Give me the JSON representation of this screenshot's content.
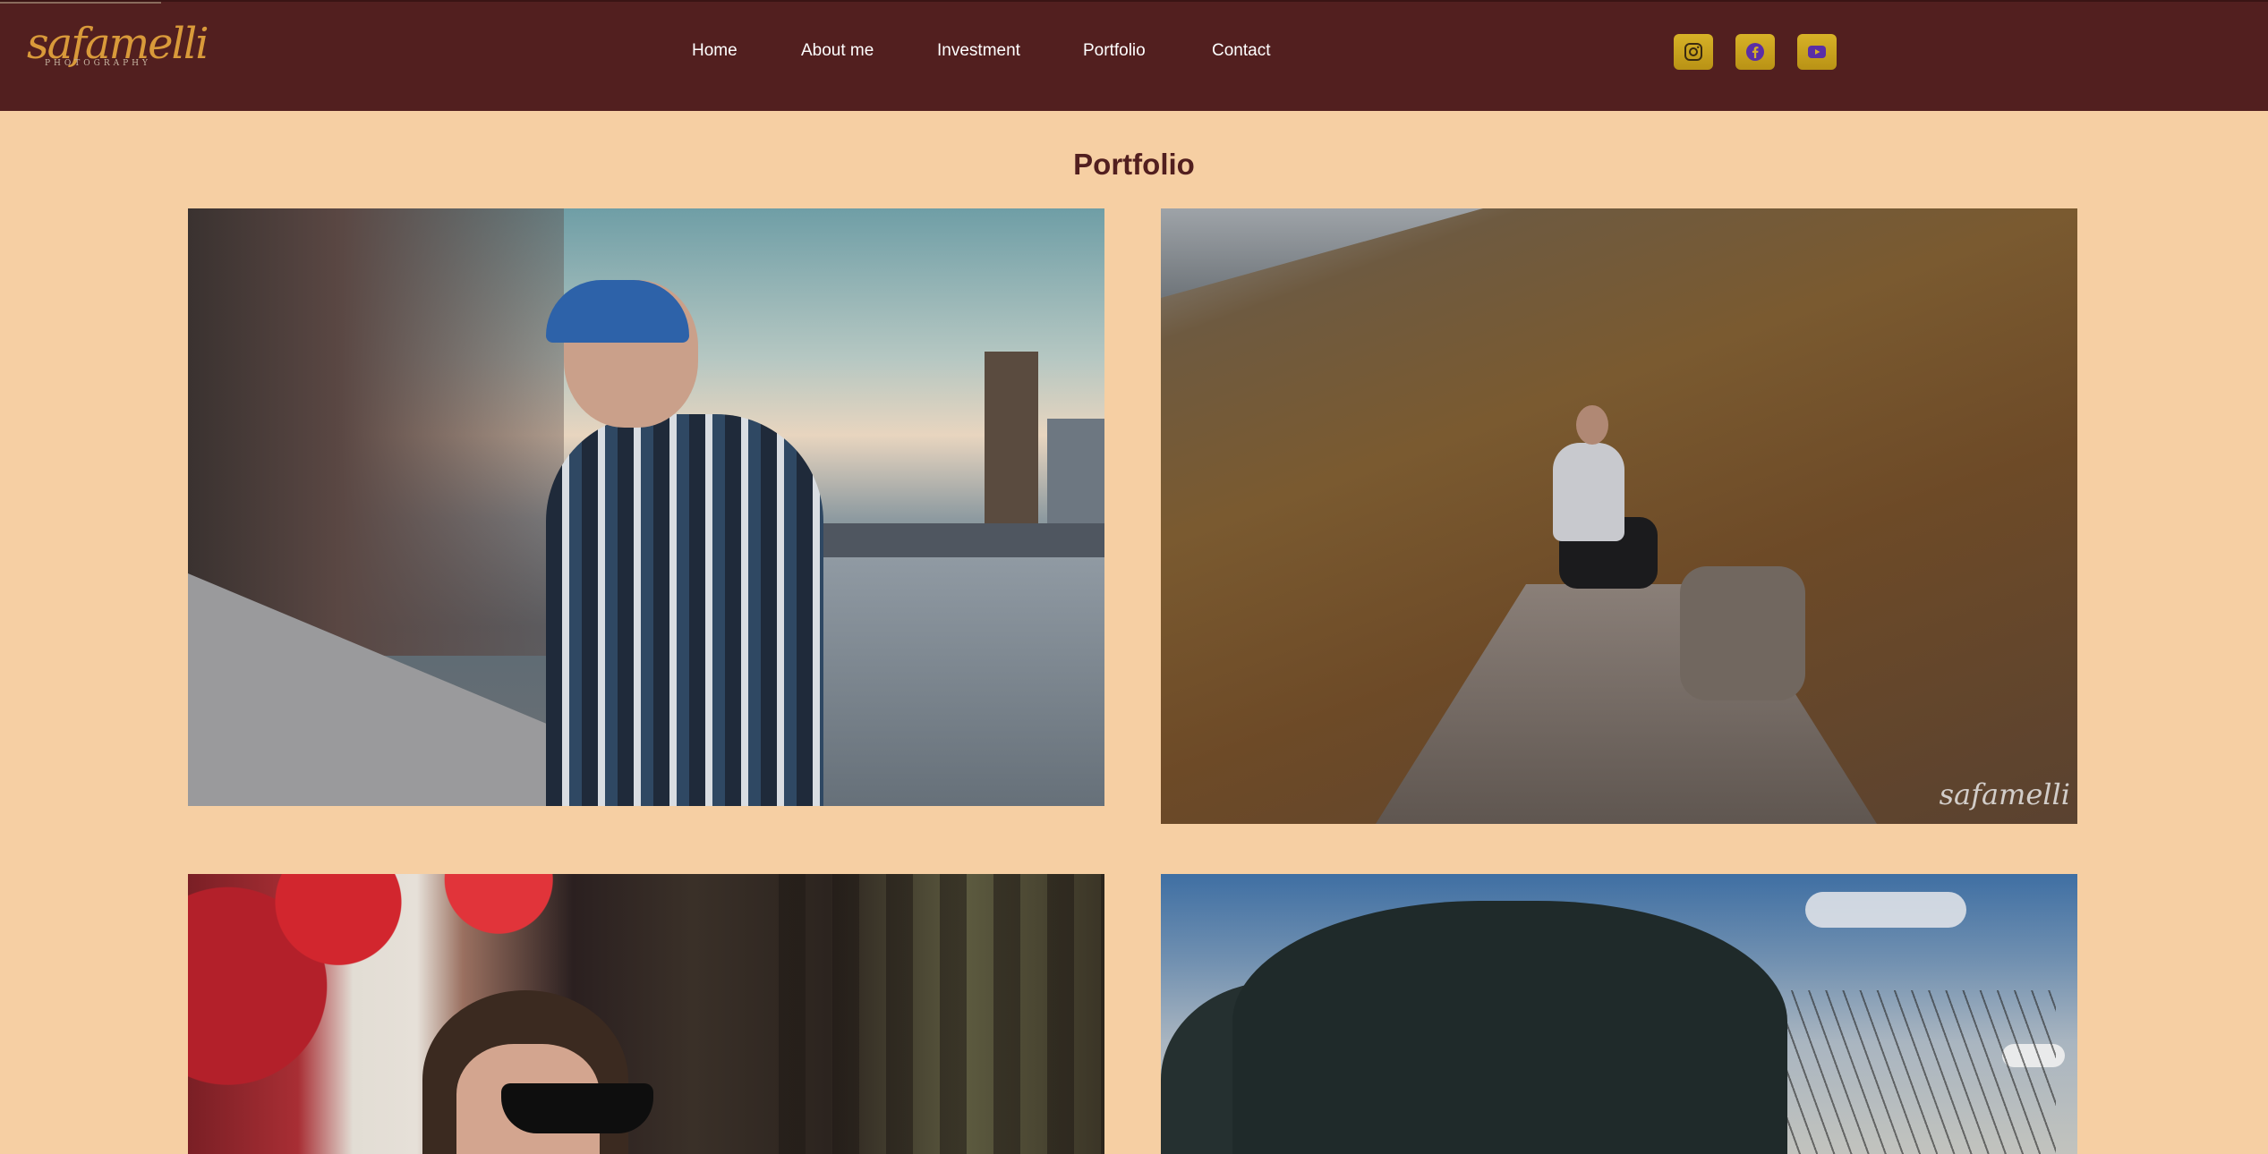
{
  "logo": {
    "script": "safamelli",
    "sub": "PHOTOGRAPHY"
  },
  "nav": {
    "items": [
      {
        "label": "Home"
      },
      {
        "label": "About me"
      },
      {
        "label": "Investment"
      },
      {
        "label": "Portfolio"
      },
      {
        "label": "Contact"
      }
    ]
  },
  "social": [
    "instagram-icon",
    "facebook-icon",
    "youtube-icon"
  ],
  "page": {
    "title": "Portfolio"
  },
  "photos": {
    "watermark": "safamelli"
  },
  "colors": {
    "header": "#521f1f",
    "background": "#f6cfa3",
    "title": "#521f1f",
    "social_button": "#c9a41f",
    "social_glyph": "#5a2ea6"
  }
}
